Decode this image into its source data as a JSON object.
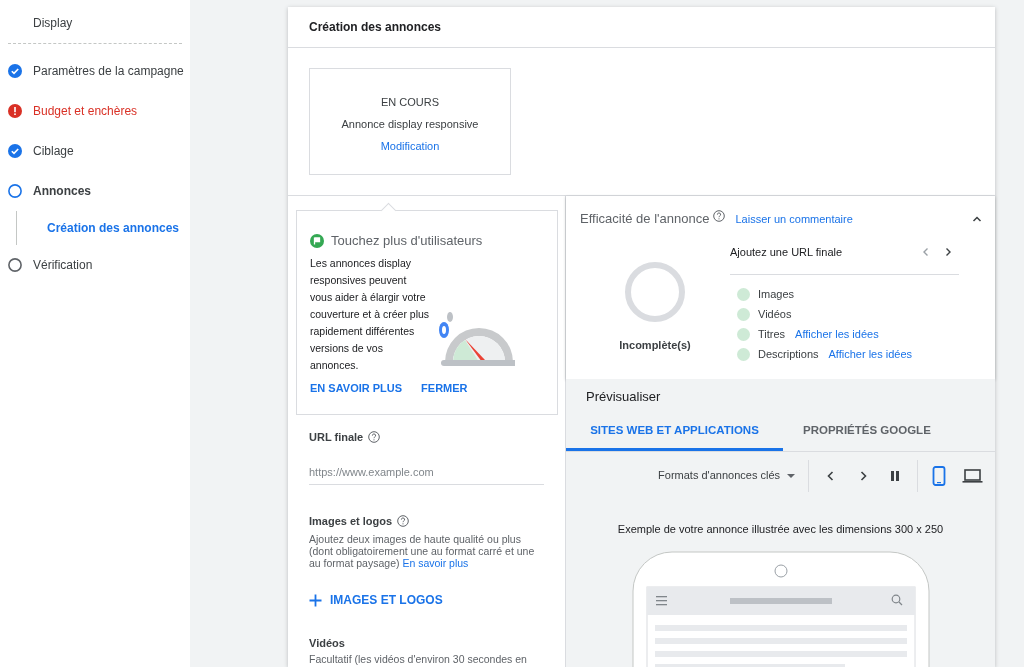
{
  "sidebar": {
    "campaign_type": "Display",
    "steps": [
      {
        "label": "Paramètres de la campagne",
        "kind": "done"
      },
      {
        "label": "Budget et enchères",
        "kind": "error"
      },
      {
        "label": "Ciblage",
        "kind": "done"
      },
      {
        "label": "Annonces",
        "kind": "current",
        "children": [
          {
            "label": "Création des annonces",
            "selected": true
          }
        ]
      },
      {
        "label": "Vérification",
        "kind": "pending"
      }
    ]
  },
  "card": {
    "title": "Création des annonces"
  },
  "ad_summary": {
    "status": "EN COURS",
    "type": "Annonce display responsive",
    "link": "Modification"
  },
  "tip": {
    "title": "Touchez plus d'utilisateurs",
    "body": "Les annonces display responsives peuvent vous aider à élargir votre couverture et à créer plus rapidement différentes versions de vos annonces.",
    "actions": [
      "EN SAVOIR PLUS",
      "FERMER"
    ]
  },
  "form": {
    "url": {
      "label": "URL finale",
      "placeholder": "https://www.example.com"
    },
    "images": {
      "label": "Images et logos",
      "help": "Ajoutez deux images de haute qualité ou plus (dont obligatoirement une au format carré et une au format paysage)",
      "link": "En savoir plus",
      "button": "IMAGES ET LOGOS"
    },
    "videos": {
      "label": "Vidéos",
      "help": "Facultatif (les vidéos d'environ 30 secondes en"
    }
  },
  "strength": {
    "title": "Efficacité de l'annonce",
    "feedback_link": "Laisser un commentaire",
    "expanded": true,
    "rating": "Incomplète(s)",
    "suggestion": "Ajoutez une URL finale",
    "checklist": [
      {
        "label": "Images"
      },
      {
        "label": "Vidéos"
      },
      {
        "label": "Titres",
        "link": "Afficher les idées"
      },
      {
        "label": "Descriptions",
        "link": "Afficher les idées"
      }
    ]
  },
  "preview": {
    "title": "Prévisualiser",
    "tabs": [
      {
        "label": "SITES WEB ET APPLICATIONS",
        "selected": true
      },
      {
        "label": "PROPRIÉTÉS GOOGLE",
        "selected": false
      }
    ],
    "format_dropdown": "Formats d'annonces clés",
    "devices": [
      {
        "kind": "mobile",
        "selected": true
      },
      {
        "kind": "desktop",
        "selected": false
      }
    ],
    "caption": "Exemple de votre annonce illustrée avec les dimensions 300 x 250"
  }
}
